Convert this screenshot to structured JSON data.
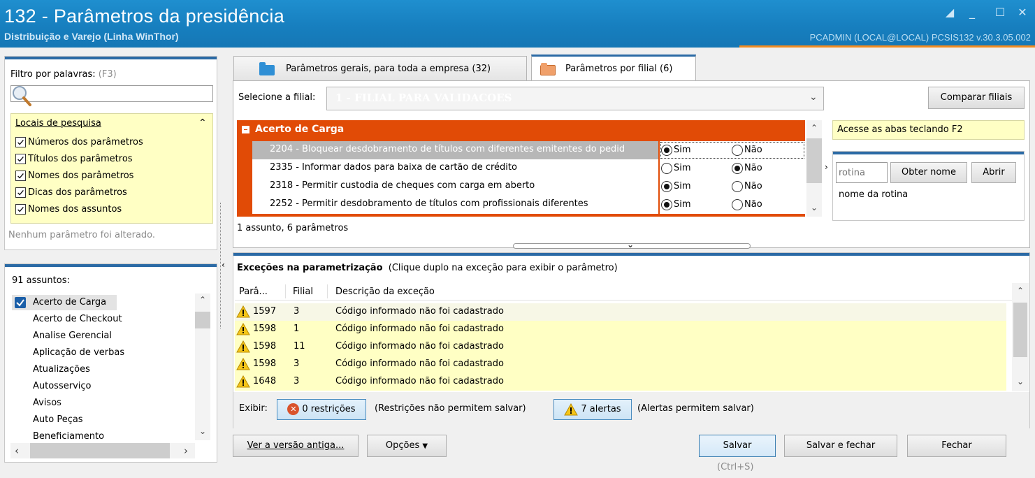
{
  "window": {
    "title": "132 - Parâmetros da presidência",
    "subtitle": "Distribuição e Varejo (Linha WinThor)",
    "user_info": "PCADMIN (LOCAL@LOCAL)   PCSIS132  v.30.3.05.002"
  },
  "filter": {
    "label": "Filtro por palavras:",
    "shortcut": "(F3)",
    "search_value": "",
    "locations_title": "Locais de pesquisa",
    "options": [
      {
        "label": "Números dos parâmetros",
        "checked": true
      },
      {
        "label": "Títulos dos parâmetros",
        "checked": true
      },
      {
        "label": "Nomes dos parâmetros",
        "checked": true
      },
      {
        "label": "Dicas dos parâmetros",
        "checked": true
      },
      {
        "label": "Nomes dos assuntos",
        "checked": true
      }
    ],
    "status": "Nenhum parâmetro foi alterado."
  },
  "subjects": {
    "count_label": "91 assuntos:",
    "items": [
      {
        "label": "Acerto de Carga",
        "checked": true
      },
      {
        "label": "Acerto de Checkout"
      },
      {
        "label": "Analise Gerencial"
      },
      {
        "label": "Aplicação de verbas"
      },
      {
        "label": "Atualizações"
      },
      {
        "label": "Autosserviço"
      },
      {
        "label": "Avisos"
      },
      {
        "label": "Auto Peças"
      },
      {
        "label": "Beneficiamento"
      }
    ]
  },
  "tabs": [
    {
      "label": "Parâmetros gerais, para toda a empresa (32)",
      "active": false
    },
    {
      "label": "Parâmetros por filial (6)",
      "active": true
    }
  ],
  "branch": {
    "label": "Selecione a filial:",
    "selected": "1 - FILIAL PARA VALIDACOES",
    "compare_button": "Comparar filiais"
  },
  "group": {
    "title": "Acerto de Carga",
    "params": [
      {
        "code": "2204 - Bloquear desdobramento de títulos com diferentes emitentes do pedid",
        "yes": "Sim",
        "no": "Não",
        "value": "Sim",
        "selected": true
      },
      {
        "code": "2335 - Informar dados para baixa de cartão de crédito",
        "yes": "Sim",
        "no": "Não",
        "value": "Não"
      },
      {
        "code": "2318 - Permitir custodia de cheques com carga em aberto",
        "yes": "Sim",
        "no": "Não",
        "value": "Sim"
      },
      {
        "code": "2252 - Permitir desdobramento de títulos com profissionais diferentes",
        "yes": "Sim",
        "no": "Não",
        "value": "Sim"
      }
    ],
    "summary": "1 assunto, 6 parâmetros"
  },
  "side": {
    "hint": "Acesse as abas teclando F2",
    "routine_placeholder": "rotina",
    "get_name_button": "Obter nome",
    "open_button": "Abrir",
    "routine_name": "nome da rotina"
  },
  "exceptions": {
    "title": "Exceções na parametrização",
    "subtitle": "(Clique duplo na exceção para exibir o parâmetro)",
    "columns": [
      "Parâ...",
      "Filial",
      "Descrição da exceção"
    ],
    "rows": [
      {
        "param": "1597",
        "branch": "3",
        "desc": "Código informado não foi cadastrado"
      },
      {
        "param": "1598",
        "branch": "1",
        "desc": "Código informado não foi cadastrado"
      },
      {
        "param": "1598",
        "branch": "11",
        "desc": "Código informado não foi cadastrado"
      },
      {
        "param": "1598",
        "branch": "3",
        "desc": "Código informado não foi cadastrado"
      },
      {
        "param": "1648",
        "branch": "3",
        "desc": "Código informado não foi cadastrado"
      }
    ],
    "show_label": "Exibir:",
    "restrictions_button": "0 restrições",
    "restrictions_note": "(Restrições não permitem salvar)",
    "alerts_button": "7 alertas",
    "alerts_note": "(Alertas permitem salvar)"
  },
  "footer": {
    "old_version": "Ver a versão antiga...",
    "options": "Opções",
    "save": "Salvar",
    "save_shortcut": "(Ctrl+S)",
    "save_close": "Salvar e fechar",
    "close": "Fechar"
  },
  "colors": {
    "titlebar": "#177fbf",
    "accent_orange": "#e14b06",
    "highlight_yellow": "#ffffc4"
  }
}
